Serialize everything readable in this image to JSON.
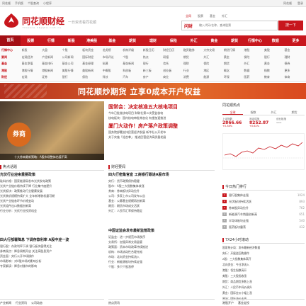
{
  "topbar": {
    "left": [
      "同花顺",
      "手机版",
      "个股查询",
      "小程序"
    ],
    "right": [
      "同花顺",
      "登录"
    ]
  },
  "header": {
    "brand": "同花顺财经",
    "brand_sub": "finance.10jqka.com.cn",
    "slogan": "一日资讯看同花顺",
    "search_tabs": [
      "全网",
      "股票",
      "基金",
      "外汇"
    ],
    "search_logo": "问财",
    "search_placeholder": "输入代码/名称，查询股票",
    "search_button": "搜一下"
  },
  "nav": [
    "首页",
    "股票",
    "行情",
    "新股",
    "港美股",
    "基金",
    "期货",
    "理财",
    "保险",
    "外汇",
    "黄金",
    "期货",
    "行情中心",
    "数据",
    "更多"
  ],
  "subnav": [
    {
      "lead": "行情中心",
      "items": [
        "新股",
        "大盘",
        "个股",
        "板块资金",
        "龙虎榜",
        "机构评级",
        "新股日历",
        "财经日历",
        "融资融券",
        "大宗交易",
        "期货行情",
        "港股",
        "美股",
        "基金"
      ]
    },
    {
      "lead": "要闻",
      "items": [
        "宏观经济",
        "产经新闻",
        "公司新闻",
        "国际财经",
        "市场评论",
        "个股",
        "热点",
        "研报",
        "期货",
        "外汇",
        "黄金",
        "保险",
        "银行",
        "理财"
      ]
    },
    {
      "lead": "基金",
      "items": [
        "基金净值",
        "基金排行",
        "基金公司",
        "基金经理",
        "私募",
        "基金新闻",
        "银行",
        "信托",
        "理财",
        "保险",
        "期货",
        "外汇",
        "黄金",
        "债券"
      ]
    },
    {
      "lead": "港股",
      "items": [
        "港股行情",
        "港股新闻",
        "美股行情",
        "美股新闻",
        "中概股",
        "科创板",
        "新三板",
        "创业板",
        "行业",
        "地区",
        "概念",
        "数据",
        "指数",
        "更多"
      ]
    },
    {
      "lead": "财经",
      "items": [
        "宏观",
        "证券",
        "银行",
        "保险",
        "科技",
        "汽车",
        "房产",
        "商业",
        "消费",
        "能源",
        "环保",
        "医药",
        "教育",
        "体育"
      ]
    }
  ],
  "banner": "同花顺炒期货 立享0成本开户权益",
  "photo": {
    "badge": "券商",
    "caption": "十大券商最新策略：A股市场整体估值不高"
  },
  "top_news": {
    "h1": "国常会：决定核准五大核电项目",
    "h1_lines": [
      "今年已批准核电项目 财联社第二次受益核电",
      "核电板块：国内核电审批常态化 有望加速推进"
    ],
    "h2": "厦门大动作！房产落户政策调整",
    "h2_lines": [
      "国务院部署支持民营经济发展 新华社公开发布",
      "关于实施「组合拳」 推进民营经济高质量发展"
    ]
  },
  "sidepanel": {
    "title": "同花顺热点",
    "tabs": [
      "全球",
      "指数",
      "外汇",
      "期货"
    ],
    "indices": [
      {
        "name": "上证指数",
        "value": "2866.66",
        "chg": "+0.38%"
      },
      {
        "name": "深证成指",
        "value": "8252.87",
        "chg": "+0.62%"
      },
      {
        "name": "创业板指",
        "value": "---",
        "chg": ""
      }
    ]
  },
  "left_sections": [
    {
      "title": "焦点话题",
      "lines": [
        {
          "t": "光伏行业迎来重要政策",
          "b": true
        },
        {
          "t": "硅料价格：国家能源局发布光伏发电政策",
          "b": false
        },
        {
          "t": "光伏产业链价格持续下降 行业集中度提升",
          "b": false
        },
        {
          "t": "光伏板块：政策推动行业健康发展",
          "b": false
        },
        {
          "t": "光伏装机规模持续扩大 全年新增装机量可期",
          "b": false
        },
        {
          "t": "光伏产业链各环节价格变动",
          "b": false
        },
        {
          "t": "光伏组件出口数据创新高",
          "b": false
        },
        {
          "t": "行业分析：光伏行业投资机会",
          "b": false
        }
      ]
    },
    {
      "title": "",
      "lines": [
        {
          "t": "四大行部署降息 下调存款利率 A股中迎一波",
          "b": true
        },
        {
          "t": "银行股：存款利率下调 银行板块值得关注",
          "b": false
        },
        {
          "t": "券商观点：降息周期开启 关注高股息资产",
          "b": false
        },
        {
          "t": "资金面：央行公开市场操作",
          "b": false
        },
        {
          "t": "市场影响：对A股市场的影响分析",
          "b": false
        },
        {
          "t": "专家解读：降息对楼市的影响",
          "b": false
        }
      ]
    }
  ],
  "mid_sections": [
    {
      "title": "财经要闻",
      "lines": [
        {
          "t": "四大行密集官宣 工商银行跟进A股市场",
          "b": true
        },
        {
          "t": "央行：货币政策保持稳健",
          "b": false
        },
        {
          "t": "股市：A股三大指数集体收涨",
          "b": false
        },
        {
          "t": "券商：券商板块异动拉升",
          "b": false
        },
        {
          "t": "公司：多家上市公司发布公告",
          "b": false
        },
        {
          "t": "基金：公募基金规模再创新高",
          "b": false
        },
        {
          "t": "期货：期货市场成交活跃",
          "b": false
        },
        {
          "t": "外汇：人民币汇率保持稳定",
          "b": false
        }
      ]
    },
    {
      "title": "",
      "lines": [
        {
          "t": "中国证监会发布最新监管政策",
          "b": true
        },
        {
          "t": "证监会：进一步规范市场秩序",
          "b": false
        },
        {
          "t": "交易所：加强异常交易监管",
          "b": false
        },
        {
          "t": "政策面：资本市场改革持续推进",
          "b": false
        },
        {
          "t": "机构：市场流动性合理充裕",
          "b": false
        },
        {
          "t": "市场：北向资金持续流入",
          "b": false
        },
        {
          "t": "行业：新能源板块持续走强",
          "b": false
        },
        {
          "t": "个股：多只个股涨停",
          "b": false
        }
      ]
    }
  ],
  "rank": {
    "title": "今日热门排行",
    "items": [
      {
        "n": "1",
        "t": "银行股集体走强",
        "c": "1024"
      },
      {
        "n": "2",
        "t": "光伏板块持续活跃",
        "c": "893"
      },
      {
        "n": "3",
        "t": "券商股异动拉升",
        "c": "762"
      },
      {
        "n": "4",
        "t": "新能源汽车销量创新高",
        "c": "651"
      },
      {
        "n": "5",
        "t": "半导体板块走强",
        "c": "540"
      },
      {
        "n": "6",
        "t": "医药板块震荡",
        "c": "432"
      }
    ]
  },
  "feed": {
    "title": "7X24小时滚动",
    "lines": [
      "国家统计局：发布最新经济数据",
      "央行：开展逆回购操作",
      "A股：三大指数集体高开",
      "北向资金：今日净流入",
      "港股：恒生指数高开",
      "美股：三大股指收涨",
      "期货：商品期货多数上涨",
      "外汇：人民币中间价调升",
      "黄金：国际金价小幅上涨",
      "原油：国际油价走高"
    ]
  },
  "bottom": {
    "left": [
      "产业新闻",
      "行业资讯",
      "公司动态"
    ],
    "mid": [
      "热点资讯"
    ],
    "right": [
      "港股开户",
      "基金定投"
    ]
  }
}
